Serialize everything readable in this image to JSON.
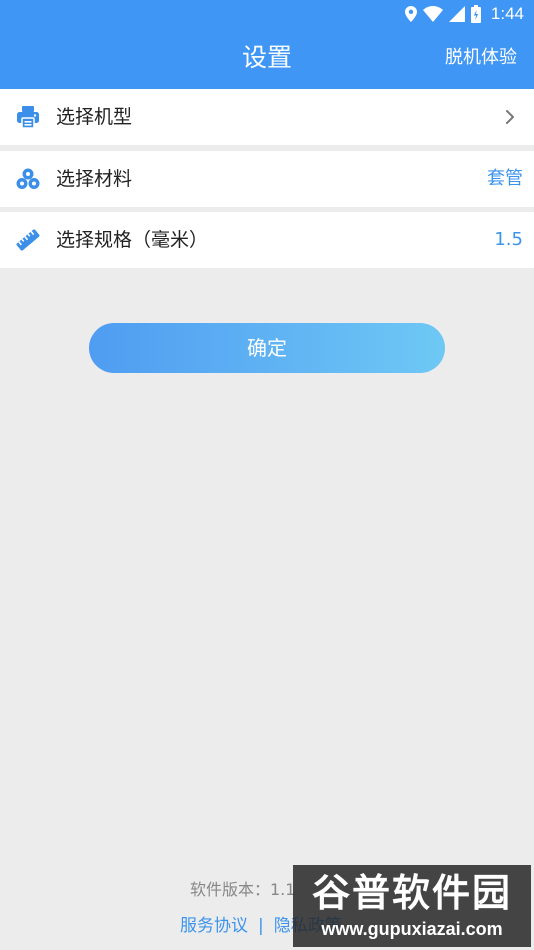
{
  "status_bar": {
    "time": "1:44",
    "icons": [
      "location-icon",
      "wifi-icon",
      "signal-icon",
      "battery-icon"
    ]
  },
  "header": {
    "title": "设置",
    "offline_label": "脱机体验"
  },
  "settings": [
    {
      "label": "选择机型",
      "value": "",
      "icon": "printer-icon"
    },
    {
      "label": "选择材料",
      "value": "套管",
      "icon": "material-rolls-icon"
    },
    {
      "label": "选择规格（毫米）",
      "value": "1.5",
      "icon": "ruler-icon"
    }
  ],
  "confirm_label": "确定",
  "footer": {
    "version_text": "软件版本：1.1",
    "service_link": "服务协议",
    "separator": "|",
    "privacy_link": "隐私政策"
  },
  "watermark": {
    "main": "谷普软件园",
    "url": "www.gupuxiazai.com"
  },
  "colors": {
    "accent": "#3f96f4",
    "value_blue": "#3b94ec",
    "background": "#ececec",
    "button_gradient_start": "#4f9cf2",
    "button_gradient_end": "#6ec8f4"
  }
}
